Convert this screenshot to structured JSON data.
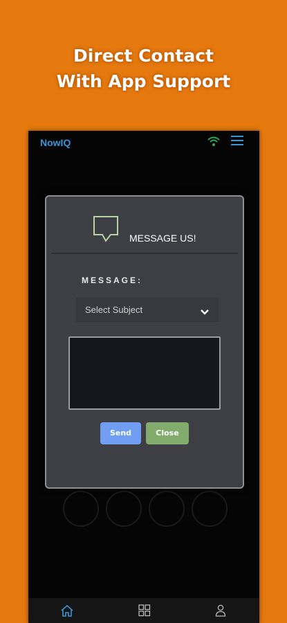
{
  "promo": {
    "line1": "Direct Contact",
    "line2": "With App Support"
  },
  "app": {
    "title": "NowIQ",
    "icons": [
      "wifi-icon",
      "hamburger-menu-icon"
    ]
  },
  "background_circles": [
    "",
    "",
    "",
    ""
  ],
  "dialog": {
    "title": "MESSAGE US!",
    "icon": "message-bubble-icon",
    "message_label": "MESSAGE:",
    "subject_select": {
      "selected": "Select Subject"
    },
    "message_body": "",
    "send_label": "Send",
    "close_label": "Close"
  },
  "bottom_nav": {
    "items": [
      {
        "icon": "home-icon"
      },
      {
        "icon": "grid-icon"
      },
      {
        "icon": "user-icon"
      }
    ]
  },
  "colors": {
    "background": "#E5790E",
    "app_title": "#3A95D6",
    "send_button": "#6F9EF3",
    "close_button": "#81AC6E",
    "icon_green": "#2FA84F"
  }
}
